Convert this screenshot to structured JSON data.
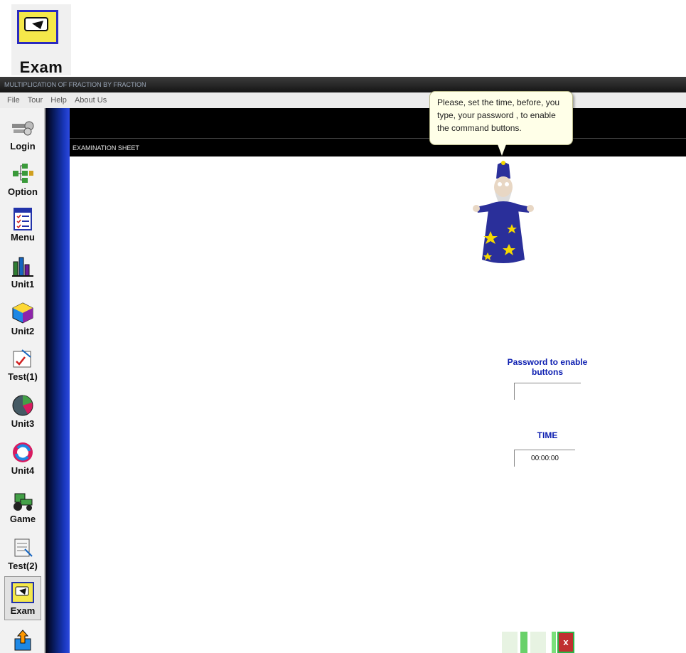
{
  "top_icon": {
    "label": "Exam",
    "icon": "exam-icon"
  },
  "window": {
    "title": "MULTIPLICATION OF FRACTION BY FRACTION"
  },
  "menu": [
    "File",
    "Tour",
    "Help",
    "About Us"
  ],
  "sidebar": {
    "items": [
      {
        "label": "Login",
        "icon": "keys-icon"
      },
      {
        "label": "Option",
        "icon": "tree-icon"
      },
      {
        "label": "Menu",
        "icon": "menu-list-icon"
      },
      {
        "label": "Unit1",
        "icon": "bar-chart-icon"
      },
      {
        "label": "Unit2",
        "icon": "cube-icon"
      },
      {
        "label": "Test(1)",
        "icon": "test-check-icon"
      },
      {
        "label": "Unit3",
        "icon": "pie-chart-icon"
      },
      {
        "label": "Unit4",
        "icon": "refresh-icon"
      },
      {
        "label": "Game",
        "icon": "tractor-icon"
      },
      {
        "label": "Test(2)",
        "icon": "scroll-icon"
      },
      {
        "label": "Exam",
        "icon": "exam-icon"
      },
      {
        "label": "",
        "icon": "export-icon"
      }
    ]
  },
  "sheet": {
    "title": "EXAMINATION SHEET"
  },
  "bubble": {
    "text": "Please, set the time, before, you type, your password , to enable the command buttons."
  },
  "password": {
    "label": "Password to enable buttons",
    "value": ""
  },
  "time": {
    "label": "TIME",
    "value": "00:00:00"
  },
  "colors": {
    "label_blue": "#0b1db0",
    "close_red": "#c03030",
    "accent_green": "#2ab646"
  }
}
